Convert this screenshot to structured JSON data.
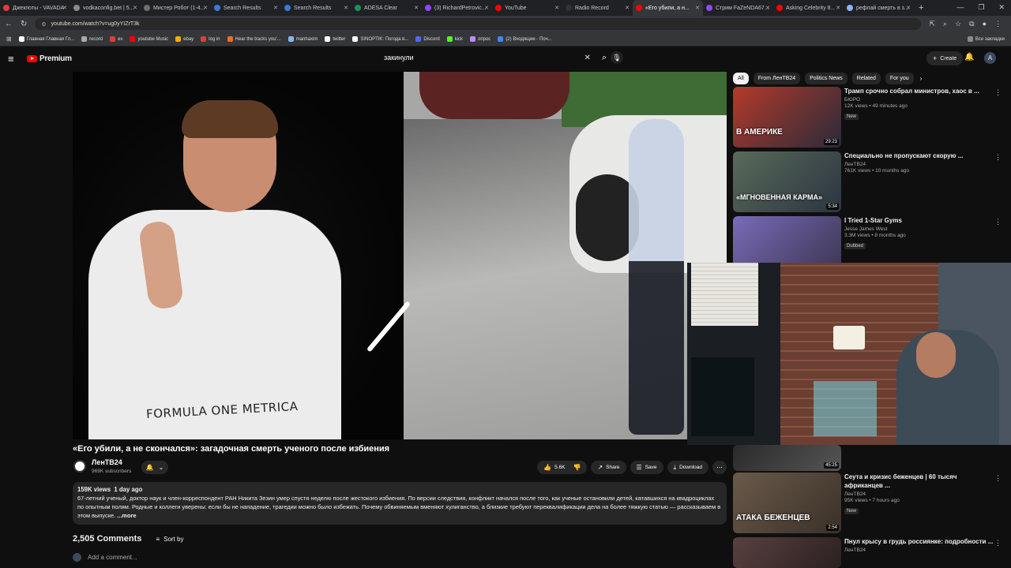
{
  "browser": {
    "tabs": [
      {
        "label": "Джекпоты - VAVADA",
        "color": "#e23b3b",
        "active": false
      },
      {
        "label": "vodkaconfig.bet | 5...",
        "color": "#8a8a8a",
        "active": false
      },
      {
        "label": "Мистер Робот (1-4...",
        "color": "#6f6f6f",
        "active": false
      },
      {
        "label": "Search Results",
        "color": "#3c78d8",
        "active": false
      },
      {
        "label": "Search Results",
        "color": "#3c78d8",
        "active": false
      },
      {
        "label": "ADESA Clear",
        "color": "#1d8f5a",
        "active": false
      },
      {
        "label": "(3) RichardPetrovic...",
        "color": "#9146ff",
        "active": false
      },
      {
        "label": "YouTube",
        "color": "#ff0000",
        "active": false
      },
      {
        "label": "Radio Record",
        "color": "#333333",
        "active": false
      },
      {
        "label": "«Его убили, а н...",
        "color": "#ff0000",
        "active": true
      },
      {
        "label": "Стрим FaZeNDA67...",
        "color": "#9146ff",
        "active": false
      },
      {
        "label": "Asking Celebrity 8...",
        "color": "#ff0000",
        "active": false
      },
      {
        "label": "рефлай смерть в з...",
        "color": "#8ab4f8",
        "active": false
      }
    ],
    "url": "youtube.com/watch?v=ug0yYIZrT3k",
    "bookmarks": [
      {
        "label": "Главная Главная Гл...",
        "color": "#ffffff"
      },
      {
        "label": "record",
        "color": "#aaaaaa"
      },
      {
        "label": "ex",
        "color": "#e23b3b"
      },
      {
        "label": "youtube Music",
        "color": "#ff0000"
      },
      {
        "label": "ebay",
        "color": "#f5af02"
      },
      {
        "label": "log in",
        "color": "#e23b3b"
      },
      {
        "label": "Hear the tracks you'...",
        "color": "#f26e22"
      },
      {
        "label": "manhaxim",
        "color": "#8ab4f8"
      },
      {
        "label": "twitter",
        "color": "#ffffff"
      },
      {
        "label": "SINOPTIK: Погода в...",
        "color": "#ffffff"
      },
      {
        "label": "Discord",
        "color": "#5865f2"
      },
      {
        "label": "kick",
        "color": "#53fc18"
      },
      {
        "label": "опрос",
        "color": "#c08bf0"
      },
      {
        "label": "(2) Входящие - Поч...",
        "color": "#4285f4"
      }
    ],
    "all_bookmarks": "Все закладки"
  },
  "header": {
    "logo_text": "Premium",
    "search_query": "закинули",
    "create_label": "Create"
  },
  "video": {
    "title": "«Его убили, а не скончался»: загадочная смерть ученого после избиения",
    "shirt_text": "FORMULA ONE METRICA",
    "channel": "ЛенТВ24",
    "subscribers": "969K subscribers",
    "likes": "5.6K",
    "share_label": "Share",
    "save_label": "Save",
    "download_label": "Download",
    "views": "159K views",
    "age": "1 day ago",
    "description": "67-летний ученый, доктор наук и член-корреспондент РАН Никита Зезин умер спустя неделю после жестокого избиения. По версии следствия, конфликт начался после того, как ученые остановили детей, катавшихся на квадроциклах по опытным полям. Родные и коллеги уверены: если бы не нападение, трагедии можно было избежать. Почему обвиняемым вменяют хулиганство, а близкие требуют переквалификации дела на более тяжкую статью — рассказываем в этом выпуске.",
    "more_label": "...more"
  },
  "comments": {
    "count": "2,505 Comments",
    "sort_label": "Sort by",
    "add_placeholder": "Add a comment..."
  },
  "chips": [
    "All",
    "From ЛенТВ24",
    "Politics News",
    "Related",
    "For you"
  ],
  "recommendations": [
    {
      "title": "Трамп срочно собрал министров, хаос в ...",
      "channel": "БЮРО",
      "views": "12K views • 49 minutes ago",
      "badge": "New",
      "duration": "29:23",
      "thumb_text": "В АМЕРИКЕ",
      "thumb_color": "#3a2a2a"
    },
    {
      "title": "Специально не пропускают скорую ...",
      "channel": "ЛенТВ24",
      "views": "761K views • 10 months ago",
      "badge": "",
      "duration": "5:34",
      "thumb_text": "«МГНОВЕННАЯ КАРМА»",
      "thumb_color": "#2f3b3f"
    },
    {
      "title": "I Tried 1-Star Gyms",
      "channel": "Jesse James West",
      "views": "3.3M views • 8 months ago",
      "badge": "Dubbed",
      "duration": "",
      "thumb_text": "",
      "thumb_color": "#6b5aa8"
    },
    {
      "title": "Сеута и кризис беженцев | 60 тысяч африканцев ...",
      "channel": "ЛенТВ24",
      "views": "95K views • 7 hours ago",
      "badge": "New",
      "duration": "2:54",
      "thumb_text": "АТАКА БЕЖЕНЦЕВ",
      "thumb_color": "#4a3d33"
    },
    {
      "title": "Пнул крысу в грудь россиянке: подробности ...",
      "channel": "ЛенТВ24",
      "views": "",
      "badge": "",
      "duration": "",
      "thumb_text": "",
      "thumb_color": "#3a3030"
    }
  ],
  "partial_duration": "45:25"
}
